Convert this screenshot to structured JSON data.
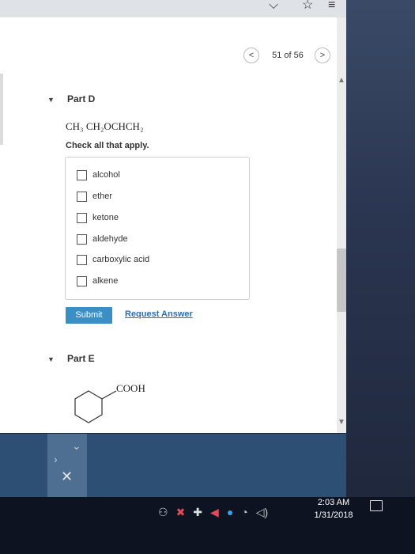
{
  "pagination": {
    "counter": "51 of 56",
    "prev": "<",
    "next": ">"
  },
  "partD": {
    "title": "Part D",
    "formula": "CH₃ CH₂OCHCH₂",
    "instruction": "Check all that apply.",
    "options": [
      {
        "label": "alcohol",
        "checked": false
      },
      {
        "label": "ether",
        "checked": false
      },
      {
        "label": "ketone",
        "checked": false
      },
      {
        "label": "aldehyde",
        "checked": false
      },
      {
        "label": "carboxylic acid",
        "checked": false
      },
      {
        "label": "alkene",
        "checked": false
      }
    ],
    "submit_label": "Submit",
    "request_answer_label": "Request Answer"
  },
  "partE": {
    "title": "Part E",
    "molecule_group": "COOH"
  },
  "taskbar": {
    "time": "2:03 AM",
    "date": "1/31/2018"
  },
  "colors": {
    "submit_bg": "#3b8fc4",
    "link": "#2a6db5",
    "taskbar_bg": "#0d1320"
  }
}
